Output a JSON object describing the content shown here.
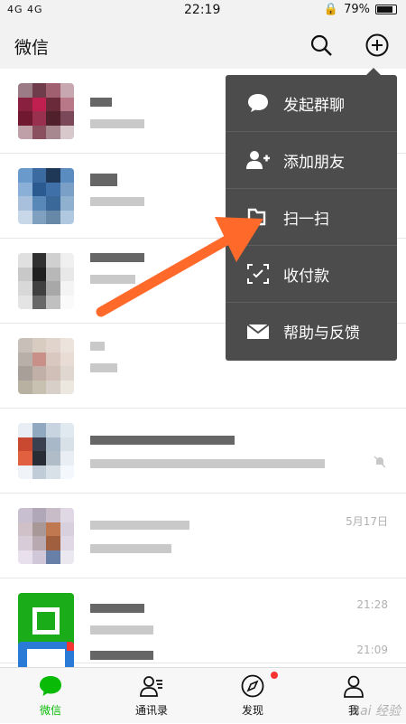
{
  "status": {
    "signal": "4G 4G",
    "time": "22:19",
    "battery": "79%"
  },
  "header": {
    "title": "微信",
    "search_icon": "search-icon",
    "add_icon": "plus-circle-icon"
  },
  "chats": [
    {
      "time": "",
      "muted": false
    },
    {
      "time": "",
      "muted": false
    },
    {
      "time": "",
      "muted": false
    },
    {
      "time": "",
      "muted": false
    },
    {
      "time": "",
      "muted": true
    },
    {
      "time": "5月17日",
      "muted": false
    },
    {
      "time": "21:28",
      "muted": false
    },
    {
      "time": "21:09",
      "muted": false
    }
  ],
  "menu": {
    "items": [
      {
        "label": "发起群聊",
        "icon": "chat-bubble-icon"
      },
      {
        "label": "添加朋友",
        "icon": "add-friend-icon"
      },
      {
        "label": "扫一扫",
        "icon": "scan-icon"
      },
      {
        "label": "收付款",
        "icon": "payment-icon"
      },
      {
        "label": "帮助与反馈",
        "icon": "mail-icon"
      }
    ]
  },
  "tabs": [
    {
      "label": "微信",
      "icon": "chat-icon",
      "active": true
    },
    {
      "label": "通讯录",
      "icon": "contacts-icon",
      "active": false
    },
    {
      "label": "发现",
      "icon": "compass-icon",
      "active": false
    },
    {
      "label": "我",
      "icon": "person-icon",
      "active": false
    }
  ],
  "watermark": "Bai 经验",
  "colors": {
    "brand": "#09bb07",
    "menu_bg": "#4c4c4c",
    "arrow": "#ff6a2b",
    "badge": "#f43530"
  }
}
